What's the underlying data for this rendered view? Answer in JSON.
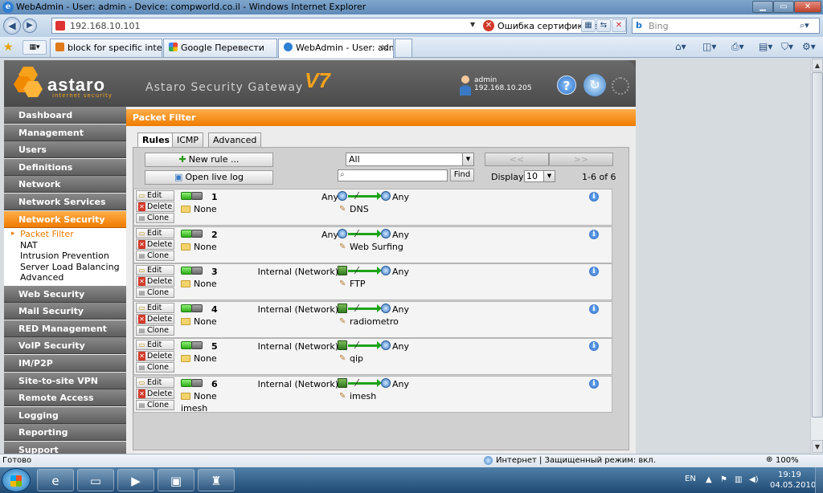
{
  "browser": {
    "title": "WebAdmin - User: admin - Device: compworld.co.il - Windows Internet Explorer",
    "url": "192.168.10.101",
    "cert_error": "Ошибка сертификата",
    "search_placeholder": "Bing",
    "tabs": [
      {
        "label": "block for specific internal ...",
        "active": false
      },
      {
        "label": "Google Перевести",
        "active": false
      },
      {
        "label": "WebAdmin - User: adm...",
        "active": true
      }
    ],
    "status_left": "Готово",
    "status_zone": "Интернет | Защищенный режим: вкл.",
    "zoom": "100%"
  },
  "header": {
    "logo_text": "astaro",
    "logo_sub": "internet security",
    "product": "Astaro Security Gateway",
    "version": "V7",
    "user_name": "admin",
    "user_ip": "192.168.10.205"
  },
  "sidebar": {
    "items_before": [
      {
        "label": "Dashboard"
      },
      {
        "label": "Management"
      },
      {
        "label": "Users"
      },
      {
        "label": "Definitions"
      },
      {
        "label": "Network"
      },
      {
        "label": "Network Services"
      }
    ],
    "active_item": "Network Security",
    "sub_items": [
      {
        "label": "Packet Filter",
        "active": true
      },
      {
        "label": "NAT",
        "active": false
      },
      {
        "label": "Intrusion Prevention",
        "active": false
      },
      {
        "label": "Server Load Balancing",
        "active": false
      },
      {
        "label": "Advanced",
        "active": false
      }
    ],
    "items_after": [
      {
        "label": "Web Security"
      },
      {
        "label": "Mail Security"
      },
      {
        "label": "RED Management"
      },
      {
        "label": "VoIP Security"
      },
      {
        "label": "IM/P2P"
      },
      {
        "label": "Site-to-site VPN"
      },
      {
        "label": "Remote Access"
      },
      {
        "label": "Logging"
      },
      {
        "label": "Reporting"
      },
      {
        "label": "Support"
      }
    ]
  },
  "content": {
    "title": "Packet Filter",
    "tabs": [
      {
        "label": "Rules",
        "active": true
      },
      {
        "label": "ICMP",
        "active": false
      },
      {
        "label": "Advanced",
        "active": false
      }
    ],
    "new_rule": "New rule ...",
    "open_live_log": "Open live log",
    "filter_value": "All",
    "find": "Find",
    "prev": "<<",
    "next": ">>",
    "display_label": "Display:",
    "display_value": "10",
    "count": "1-6 of 6"
  },
  "rule_actions": {
    "edit": "Edit",
    "delete": "Delete",
    "clone": "Clone"
  },
  "rules": [
    {
      "num": "1",
      "group": "None",
      "source": "Any",
      "source_type": "globe",
      "destination": "Any",
      "service": "DNS",
      "desc": ""
    },
    {
      "num": "2",
      "group": "None",
      "source": "Any",
      "source_type": "globe",
      "destination": "Any",
      "service": "Web Surfing",
      "desc": ""
    },
    {
      "num": "3",
      "group": "None",
      "source": "Internal (Network)",
      "source_type": "network",
      "destination": "Any",
      "service": "FTP",
      "desc": ""
    },
    {
      "num": "4",
      "group": "None",
      "source": "Internal (Network)",
      "source_type": "network",
      "destination": "Any",
      "service": "radiometro",
      "desc": ""
    },
    {
      "num": "5",
      "group": "None",
      "source": "Internal (Network)",
      "source_type": "network",
      "destination": "Any",
      "service": "qip",
      "desc": ""
    },
    {
      "num": "6",
      "group": "None",
      "source": "Internal (Network)",
      "source_type": "network",
      "destination": "Any",
      "service": "imesh",
      "desc": "imesh"
    }
  ],
  "taskbar": {
    "lang": "EN",
    "time": "19:19",
    "date": "04.05.2010"
  },
  "colors": {
    "accent": "#f07b00",
    "header_gray": "#4a4a4a",
    "flow_green": "#1fa31a"
  },
  "icons": {
    "rule_status": "toggle-on-icon",
    "rule_group": "folder-icon",
    "rule_info": "info-icon",
    "help": "help-icon",
    "reload": "reload-icon"
  }
}
